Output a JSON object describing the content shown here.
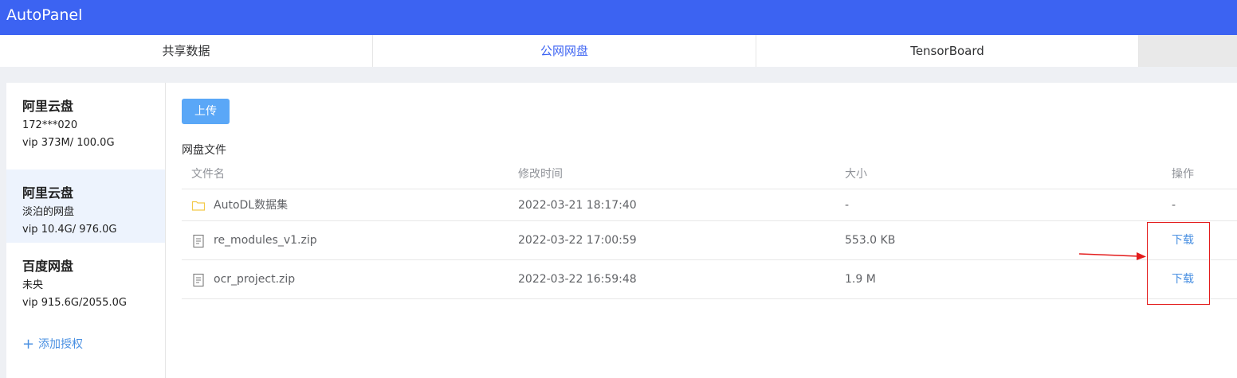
{
  "app": {
    "title": "AutoPanel"
  },
  "tabs": [
    {
      "label": "共享数据"
    },
    {
      "label": "公网网盘",
      "active": true
    },
    {
      "label": "TensorBoard"
    }
  ],
  "sidebar": {
    "accounts": [
      {
        "name": "阿里云盘",
        "user": "172***020",
        "quota": "vip 373M/ 100.0G"
      },
      {
        "name": "阿里云盘",
        "user": "淡泊的网盘",
        "quota": "vip 10.4G/ 976.0G",
        "active": true
      },
      {
        "name": "百度网盘",
        "user": "未央",
        "quota": "vip 915.6G/2055.0G"
      }
    ],
    "add_auth_label": "添加授权"
  },
  "main": {
    "upload_label": "上传",
    "section_title": "网盘文件",
    "table": {
      "headers": {
        "name": "文件名",
        "time": "修改时间",
        "size": "大小",
        "op": "操作"
      },
      "rows": [
        {
          "icon": "folder-icon",
          "name": "AutoDL数据集",
          "time": "2022-03-21 18:17:40",
          "size": "-",
          "op": "-"
        },
        {
          "icon": "file-icon",
          "name": "re_modules_v1.zip",
          "time": "2022-03-22 17:00:59",
          "size": "553.0 KB",
          "op": "下载"
        },
        {
          "icon": "file-icon",
          "name": "ocr_project.zip",
          "time": "2022-03-22 16:59:48",
          "size": "1.9 M",
          "op": "下载"
        }
      ]
    }
  },
  "colors": {
    "topbar": "#3c63f2",
    "accent": "#3c63f2",
    "link": "#4a90e2",
    "upload_button": "#5aa7f7",
    "annotation": "#e31b1b"
  }
}
